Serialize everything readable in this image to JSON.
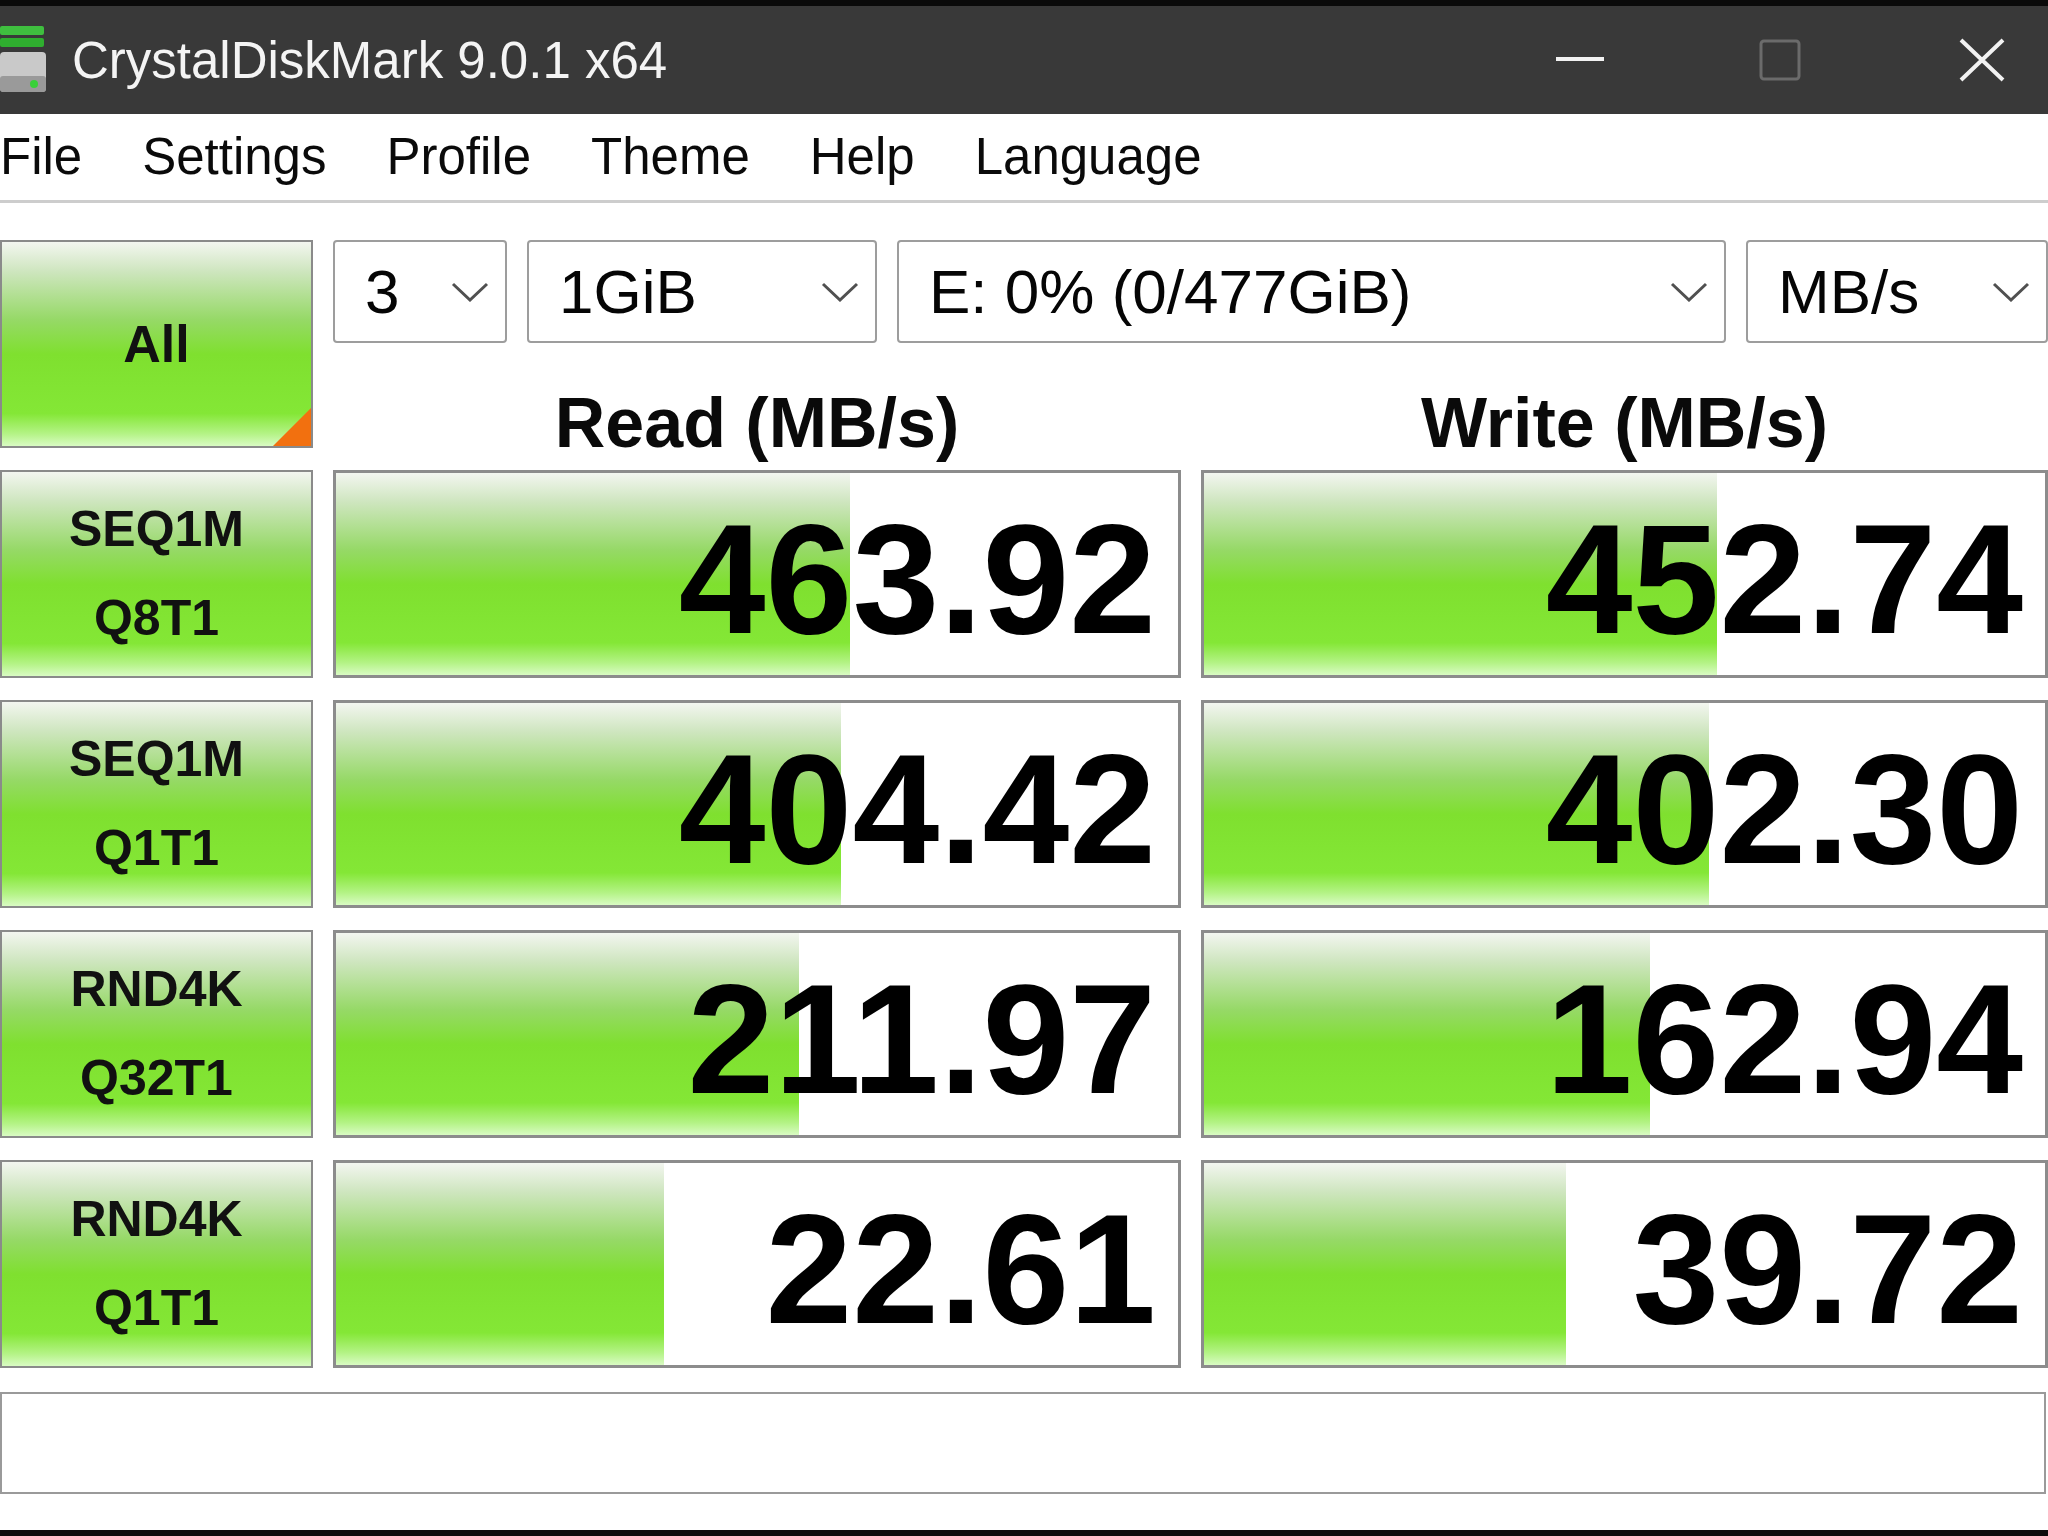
{
  "window": {
    "title": "CrystalDiskMark 9.0.1 x64",
    "maximize_disabled": true
  },
  "menu": [
    {
      "label": "File"
    },
    {
      "label": "Settings"
    },
    {
      "label": "Profile"
    },
    {
      "label": "Theme"
    },
    {
      "label": "Help"
    },
    {
      "label": "Language"
    }
  ],
  "all_button": {
    "label": "All"
  },
  "selectors": [
    {
      "value": "3"
    },
    {
      "value": "1GiB"
    },
    {
      "value": "E: 0% (0/477GiB)"
    },
    {
      "value": "MB/s"
    }
  ],
  "columns": [
    "Read (MB/s)",
    "Write (MB/s)"
  ],
  "tests": [
    {
      "label": [
        "SEQ1M",
        "Q8T1"
      ],
      "read": {
        "reading": "463.92",
        "level": 0.61
      },
      "write": {
        "reading": "452.74",
        "level": 0.61
      }
    },
    {
      "label": [
        "SEQ1M",
        "Q1T1"
      ],
      "read": {
        "reading": "404.42",
        "level": 0.6
      },
      "write": {
        "reading": "402.30",
        "level": 0.6
      }
    },
    {
      "label": [
        "RND4K",
        "Q32T1"
      ],
      "read": {
        "reading": "211.97",
        "level": 0.55
      },
      "write": {
        "reading": "162.94",
        "level": 0.53
      }
    },
    {
      "label": [
        "RND4K",
        "Q1T1"
      ],
      "read": {
        "reading": "22.61",
        "level": 0.39
      },
      "write": {
        "reading": "39.72",
        "level": 0.43
      }
    }
  ]
}
